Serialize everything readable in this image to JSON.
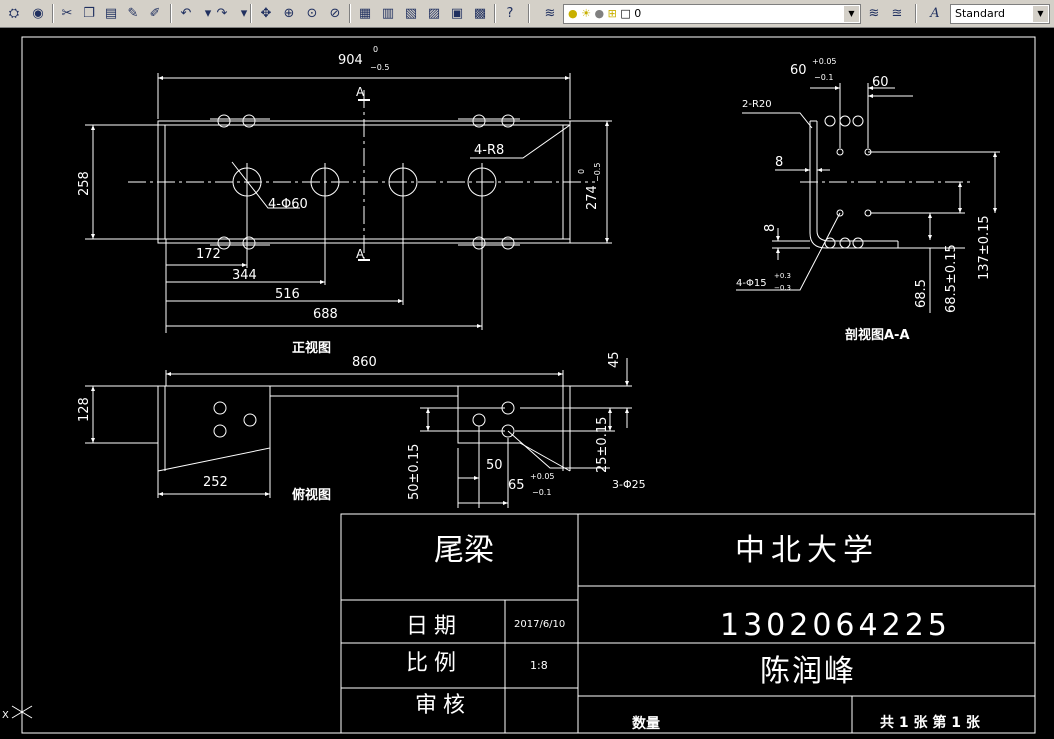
{
  "toolbar": {
    "layer_value": "0",
    "style_value": "Standard"
  },
  "front_view": {
    "label": "正视图",
    "dims": {
      "overall_width_value": "904",
      "overall_width_tol_upper": "0",
      "overall_width_tol_lower": "−0.5",
      "height_258": "258",
      "height_274": "274",
      "height_274_tol_upper": "0",
      "height_274_tol_lower": "−0.5",
      "hole_callout": "4-Φ60",
      "radius_callout": "4-R8",
      "d172": "172",
      "d344": "344",
      "d516": "516",
      "d688": "688",
      "section_mark_top": "A",
      "section_mark_bottom": "A"
    }
  },
  "side_view": {
    "label": "俯视图",
    "dims": {
      "d860": "860",
      "d128": "128",
      "d252": "252",
      "d45": "45",
      "d50": "50",
      "d65": "65",
      "d65_tol_upper": "+0.05",
      "d65_tol_lower": "−0.1",
      "d50_tol": "50±0.15",
      "d25_tol": "25±0.15",
      "hole_callout": "3-Φ25"
    }
  },
  "section_view": {
    "label": "剖视图A-A",
    "dims": {
      "d60_tol": "60",
      "d60_tol_upper": "+0.05",
      "d60_tol_lower": "−0.1",
      "d60": "60",
      "radius_callout": "2-R20",
      "d8_top": "8",
      "d8_bottom": "8",
      "hole_callout": "4-Φ15",
      "hole_tol_upper": "+0.3",
      "hole_tol_lower": "−0.3",
      "d68": "68.5",
      "d68_tol": "68.5±0.15",
      "d137_tol": "137±0.15"
    }
  },
  "title_block": {
    "part_name": "尾梁",
    "school": "中北大学",
    "date_label": "日期",
    "date_value": "2017/6/10",
    "scale_label": "比例",
    "scale_value": "1:8",
    "review_label": "审核",
    "student_id": "1302064225",
    "student_name": "陈润峰",
    "quantity_label": "数量",
    "sheet_info": "共 1 张 第 1 张"
  },
  "ucs": {
    "x_label": "X"
  },
  "colors": {
    "canvas": "#000000",
    "line": "#ffffff",
    "toolbar": "#d4d0c8"
  }
}
